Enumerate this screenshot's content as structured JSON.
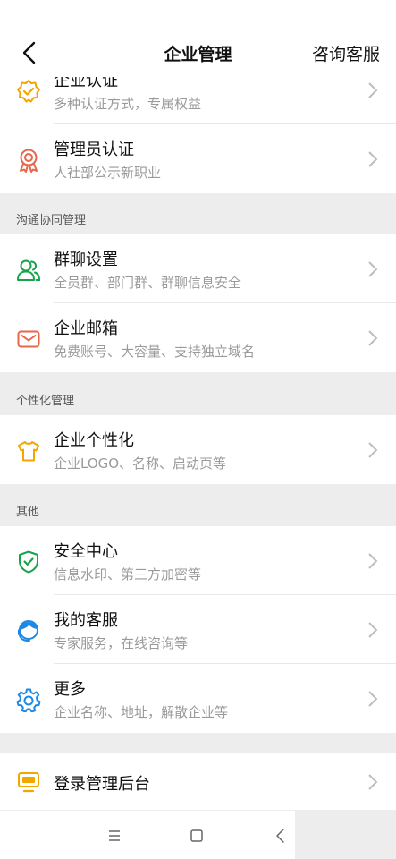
{
  "header": {
    "title": "企业管理",
    "contact_label": "咨询客服"
  },
  "items": {
    "enterprise_cert": {
      "label": "企业认证",
      "sub": "多种认证方式，专属权益",
      "icon": "check-badge-icon",
      "color": "#f2a600"
    },
    "admin_cert": {
      "label": "管理员认证",
      "sub": "人社部公示新职业",
      "icon": "award-ribbon-icon",
      "color": "#e8664a"
    },
    "group_chat": {
      "label": "群聊设置",
      "sub": "全员群、部门群、群聊信息安全",
      "icon": "group-users-icon",
      "color": "#16a34a"
    },
    "mail": {
      "label": "企业邮箱",
      "sub": "免费账号、大容量、支持独立域名",
      "icon": "mail-icon",
      "color": "#e8664a"
    },
    "personalize": {
      "label": "企业个性化",
      "sub": "企业LOGO、名称、启动页等",
      "icon": "tshirt-icon",
      "color": "#f2a600"
    },
    "security": {
      "label": "安全中心",
      "sub": "信息水印、第三方加密等",
      "icon": "shield-check-icon",
      "color": "#16a34a"
    },
    "service": {
      "label": "我的客服",
      "sub": "专家服务，在线咨询等",
      "icon": "support-agent-icon",
      "color": "#1e88e5"
    },
    "more": {
      "label": "更多",
      "sub": "企业名称、地址，解散企业等",
      "icon": "gear-icon",
      "color": "#1e88e5"
    },
    "admin_console": {
      "label": "登录管理后台",
      "icon": "monitor-icon",
      "color": "#f2a600"
    }
  },
  "sections": {
    "collab": "沟通协同管理",
    "personal": "个性化管理",
    "other": "其他"
  },
  "navbar": {
    "icons": [
      "menu-icon",
      "home-square-icon",
      "back-triangle-icon"
    ]
  }
}
